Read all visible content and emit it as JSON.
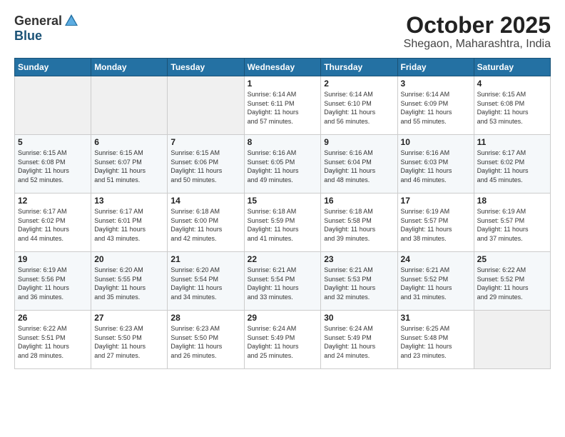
{
  "header": {
    "logo_general": "General",
    "logo_blue": "Blue",
    "month": "October 2025",
    "location": "Shegaon, Maharashtra, India"
  },
  "weekdays": [
    "Sunday",
    "Monday",
    "Tuesday",
    "Wednesday",
    "Thursday",
    "Friday",
    "Saturday"
  ],
  "weeks": [
    [
      {
        "day": "",
        "info": ""
      },
      {
        "day": "",
        "info": ""
      },
      {
        "day": "",
        "info": ""
      },
      {
        "day": "1",
        "info": "Sunrise: 6:14 AM\nSunset: 6:11 PM\nDaylight: 11 hours\nand 57 minutes."
      },
      {
        "day": "2",
        "info": "Sunrise: 6:14 AM\nSunset: 6:10 PM\nDaylight: 11 hours\nand 56 minutes."
      },
      {
        "day": "3",
        "info": "Sunrise: 6:14 AM\nSunset: 6:09 PM\nDaylight: 11 hours\nand 55 minutes."
      },
      {
        "day": "4",
        "info": "Sunrise: 6:15 AM\nSunset: 6:08 PM\nDaylight: 11 hours\nand 53 minutes."
      }
    ],
    [
      {
        "day": "5",
        "info": "Sunrise: 6:15 AM\nSunset: 6:08 PM\nDaylight: 11 hours\nand 52 minutes."
      },
      {
        "day": "6",
        "info": "Sunrise: 6:15 AM\nSunset: 6:07 PM\nDaylight: 11 hours\nand 51 minutes."
      },
      {
        "day": "7",
        "info": "Sunrise: 6:15 AM\nSunset: 6:06 PM\nDaylight: 11 hours\nand 50 minutes."
      },
      {
        "day": "8",
        "info": "Sunrise: 6:16 AM\nSunset: 6:05 PM\nDaylight: 11 hours\nand 49 minutes."
      },
      {
        "day": "9",
        "info": "Sunrise: 6:16 AM\nSunset: 6:04 PM\nDaylight: 11 hours\nand 48 minutes."
      },
      {
        "day": "10",
        "info": "Sunrise: 6:16 AM\nSunset: 6:03 PM\nDaylight: 11 hours\nand 46 minutes."
      },
      {
        "day": "11",
        "info": "Sunrise: 6:17 AM\nSunset: 6:02 PM\nDaylight: 11 hours\nand 45 minutes."
      }
    ],
    [
      {
        "day": "12",
        "info": "Sunrise: 6:17 AM\nSunset: 6:02 PM\nDaylight: 11 hours\nand 44 minutes."
      },
      {
        "day": "13",
        "info": "Sunrise: 6:17 AM\nSunset: 6:01 PM\nDaylight: 11 hours\nand 43 minutes."
      },
      {
        "day": "14",
        "info": "Sunrise: 6:18 AM\nSunset: 6:00 PM\nDaylight: 11 hours\nand 42 minutes."
      },
      {
        "day": "15",
        "info": "Sunrise: 6:18 AM\nSunset: 5:59 PM\nDaylight: 11 hours\nand 41 minutes."
      },
      {
        "day": "16",
        "info": "Sunrise: 6:18 AM\nSunset: 5:58 PM\nDaylight: 11 hours\nand 39 minutes."
      },
      {
        "day": "17",
        "info": "Sunrise: 6:19 AM\nSunset: 5:57 PM\nDaylight: 11 hours\nand 38 minutes."
      },
      {
        "day": "18",
        "info": "Sunrise: 6:19 AM\nSunset: 5:57 PM\nDaylight: 11 hours\nand 37 minutes."
      }
    ],
    [
      {
        "day": "19",
        "info": "Sunrise: 6:19 AM\nSunset: 5:56 PM\nDaylight: 11 hours\nand 36 minutes."
      },
      {
        "day": "20",
        "info": "Sunrise: 6:20 AM\nSunset: 5:55 PM\nDaylight: 11 hours\nand 35 minutes."
      },
      {
        "day": "21",
        "info": "Sunrise: 6:20 AM\nSunset: 5:54 PM\nDaylight: 11 hours\nand 34 minutes."
      },
      {
        "day": "22",
        "info": "Sunrise: 6:21 AM\nSunset: 5:54 PM\nDaylight: 11 hours\nand 33 minutes."
      },
      {
        "day": "23",
        "info": "Sunrise: 6:21 AM\nSunset: 5:53 PM\nDaylight: 11 hours\nand 32 minutes."
      },
      {
        "day": "24",
        "info": "Sunrise: 6:21 AM\nSunset: 5:52 PM\nDaylight: 11 hours\nand 31 minutes."
      },
      {
        "day": "25",
        "info": "Sunrise: 6:22 AM\nSunset: 5:52 PM\nDaylight: 11 hours\nand 29 minutes."
      }
    ],
    [
      {
        "day": "26",
        "info": "Sunrise: 6:22 AM\nSunset: 5:51 PM\nDaylight: 11 hours\nand 28 minutes."
      },
      {
        "day": "27",
        "info": "Sunrise: 6:23 AM\nSunset: 5:50 PM\nDaylight: 11 hours\nand 27 minutes."
      },
      {
        "day": "28",
        "info": "Sunrise: 6:23 AM\nSunset: 5:50 PM\nDaylight: 11 hours\nand 26 minutes."
      },
      {
        "day": "29",
        "info": "Sunrise: 6:24 AM\nSunset: 5:49 PM\nDaylight: 11 hours\nand 25 minutes."
      },
      {
        "day": "30",
        "info": "Sunrise: 6:24 AM\nSunset: 5:49 PM\nDaylight: 11 hours\nand 24 minutes."
      },
      {
        "day": "31",
        "info": "Sunrise: 6:25 AM\nSunset: 5:48 PM\nDaylight: 11 hours\nand 23 minutes."
      },
      {
        "day": "",
        "info": ""
      }
    ]
  ]
}
